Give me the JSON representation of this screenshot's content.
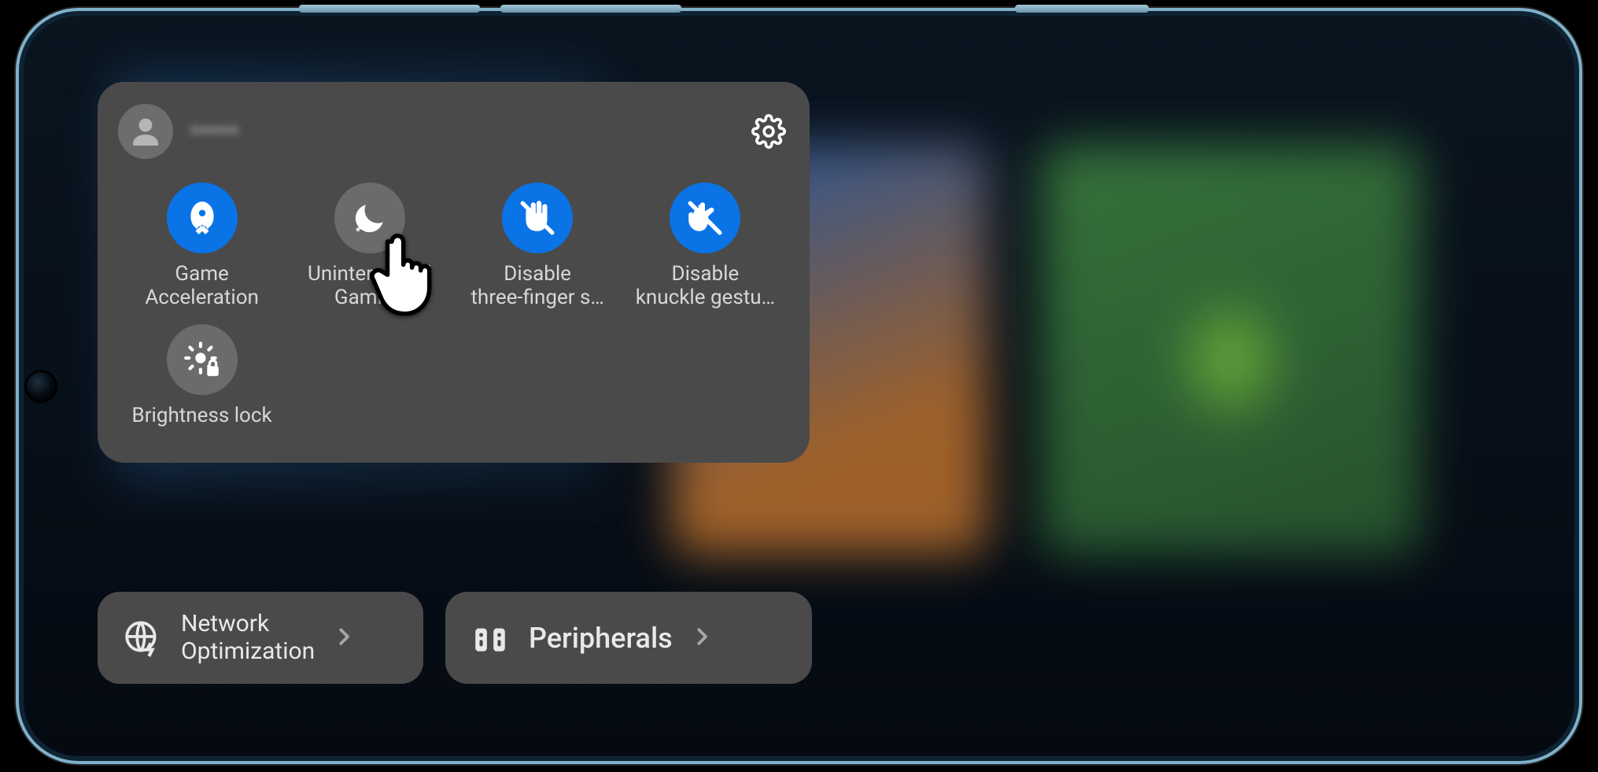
{
  "user": {
    "name_obscured": "•••••"
  },
  "colors": {
    "accent_on": "#0a73e6",
    "accent_off": "#6b6b6b",
    "panel": "#4a4a4a"
  },
  "panel": {
    "settings_icon": "gear",
    "tiles": [
      {
        "id": "game-acceleration",
        "label": "Game\nAcceleration",
        "active": true,
        "icon": "rocket"
      },
      {
        "id": "uninterrupted-gaming",
        "label": "Uninterrupted\nGaming",
        "active": false,
        "icon": "moon"
      },
      {
        "id": "disable-three-finger",
        "label": "Disable\nthree-finger s…",
        "active": true,
        "icon": "three-finger-off"
      },
      {
        "id": "disable-knuckle",
        "label": "Disable\nknuckle gestu…",
        "active": true,
        "icon": "knuckle-off"
      },
      {
        "id": "brightness-lock",
        "label": "Brightness lock",
        "active": false,
        "icon": "brightness-lock"
      }
    ]
  },
  "bottom": {
    "network": {
      "label": "Network\nOptimization",
      "icon": "globe-bolt"
    },
    "peripherals": {
      "label": "Peripherals",
      "icon": "controller"
    }
  },
  "pointer_target": "uninterrupted-gaming"
}
